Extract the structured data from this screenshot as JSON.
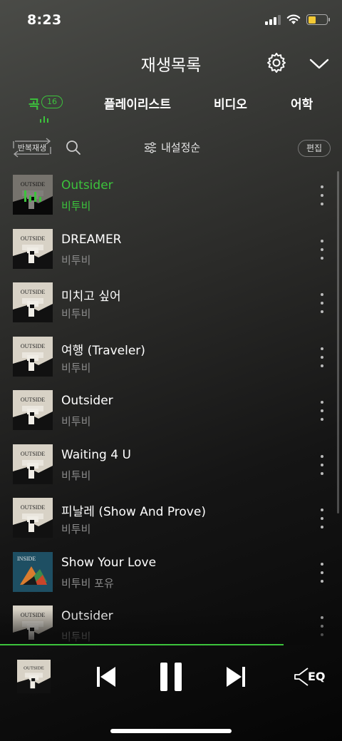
{
  "status_bar": {
    "time": "8:23"
  },
  "header": {
    "title": "재생목록"
  },
  "tabs": [
    {
      "label": "곡",
      "count": "16",
      "active": true
    },
    {
      "label": "플레이리스트"
    },
    {
      "label": "비디오"
    },
    {
      "label": "어학"
    }
  ],
  "toolbar": {
    "repeat_label": "반복재생",
    "sort_label": "내설정순",
    "edit_label": "편집"
  },
  "songs": [
    {
      "title": "Outsider",
      "artist": "비투비",
      "album": "outside",
      "playing": true
    },
    {
      "title": "DREAMER",
      "artist": "비투비",
      "album": "outside"
    },
    {
      "title": "미치고 싶어",
      "artist": "비투비",
      "album": "outside"
    },
    {
      "title": "여행 (Traveler)",
      "artist": "비투비",
      "album": "outside"
    },
    {
      "title": "Outsider",
      "artist": "비투비",
      "album": "outside"
    },
    {
      "title": "Waiting 4 U",
      "artist": "비투비",
      "album": "outside"
    },
    {
      "title": "피날레 (Show And Prove)",
      "artist": "비투비",
      "album": "outside"
    },
    {
      "title": "Show Your Love",
      "artist": "비투비 포유",
      "album": "inside"
    },
    {
      "title": "Outsider",
      "artist": "비투비",
      "album": "outside"
    }
  ],
  "album_art": {
    "outside_text": "OUTSIDE",
    "inside_text": "INSIDE"
  },
  "player": {
    "eq_label": "EQ",
    "progress_fraction": 0.83
  },
  "colors": {
    "accent": "#3cc33c",
    "text_secondary": "#8a8a8a"
  }
}
